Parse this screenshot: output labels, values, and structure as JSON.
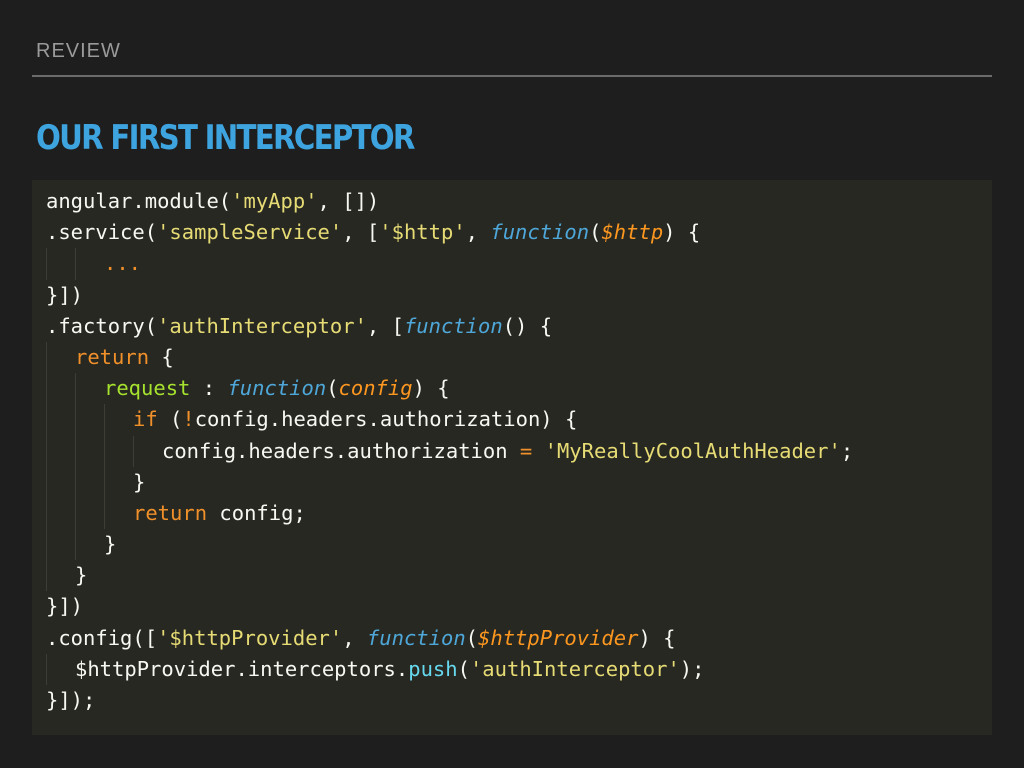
{
  "slide": {
    "section_label": "REVIEW",
    "title": "OUR FIRST INTERCEPTOR"
  },
  "code": {
    "language": "javascript",
    "lines": [
      {
        "indent": 0,
        "tokens": [
          {
            "t": "angular.module(",
            "k": "plain"
          },
          {
            "t": "'myApp'",
            "k": "string"
          },
          {
            "t": ", [])",
            "k": "plain"
          }
        ]
      },
      {
        "indent": 0,
        "tokens": [
          {
            "t": ".service(",
            "k": "plain"
          },
          {
            "t": "'sampleService'",
            "k": "string"
          },
          {
            "t": ", [",
            "k": "plain"
          },
          {
            "t": "'$http'",
            "k": "string"
          },
          {
            "t": ", ",
            "k": "plain"
          },
          {
            "t": "function",
            "k": "func"
          },
          {
            "t": "(",
            "k": "plain"
          },
          {
            "t": "$http",
            "k": "param"
          },
          {
            "t": ") {",
            "k": "plain"
          }
        ]
      },
      {
        "indent": 2,
        "tokens": [
          {
            "t": "...",
            "k": "kw"
          }
        ]
      },
      {
        "indent": 0,
        "tokens": [
          {
            "t": "}])",
            "k": "plain"
          }
        ]
      },
      {
        "indent": 0,
        "tokens": [
          {
            "t": ".factory(",
            "k": "plain"
          },
          {
            "t": "'authInterceptor'",
            "k": "string"
          },
          {
            "t": ", [",
            "k": "plain"
          },
          {
            "t": "function",
            "k": "func"
          },
          {
            "t": "() {",
            "k": "plain"
          }
        ]
      },
      {
        "indent": 1,
        "tokens": [
          {
            "t": "return",
            "k": "kw"
          },
          {
            "t": " {",
            "k": "plain"
          }
        ]
      },
      {
        "indent": 2,
        "tokens": [
          {
            "t": "request",
            "k": "prop"
          },
          {
            "t": " : ",
            "k": "plain"
          },
          {
            "t": "function",
            "k": "func"
          },
          {
            "t": "(",
            "k": "plain"
          },
          {
            "t": "config",
            "k": "param"
          },
          {
            "t": ") {",
            "k": "plain"
          }
        ]
      },
      {
        "indent": 3,
        "tokens": [
          {
            "t": "if",
            "k": "kw"
          },
          {
            "t": " (",
            "k": "plain"
          },
          {
            "t": "!",
            "k": "kw"
          },
          {
            "t": "config.headers.authorization) {",
            "k": "plain"
          }
        ]
      },
      {
        "indent": 4,
        "tokens": [
          {
            "t": "config.headers.authorization ",
            "k": "plain"
          },
          {
            "t": "=",
            "k": "kw"
          },
          {
            "t": " ",
            "k": "plain"
          },
          {
            "t": "'MyReallyCoolAuthHeader'",
            "k": "string"
          },
          {
            "t": ";",
            "k": "plain"
          }
        ]
      },
      {
        "indent": 3,
        "tokens": [
          {
            "t": "}",
            "k": "plain"
          }
        ]
      },
      {
        "indent": 3,
        "tokens": [
          {
            "t": "return",
            "k": "kw"
          },
          {
            "t": " config;",
            "k": "plain"
          }
        ]
      },
      {
        "indent": 2,
        "tokens": [
          {
            "t": "}",
            "k": "plain"
          }
        ]
      },
      {
        "indent": 1,
        "tokens": [
          {
            "t": "}",
            "k": "plain"
          }
        ]
      },
      {
        "indent": 0,
        "tokens": [
          {
            "t": "}])",
            "k": "plain"
          }
        ]
      },
      {
        "indent": 0,
        "tokens": [
          {
            "t": ".config([",
            "k": "plain"
          },
          {
            "t": "'$httpProvider'",
            "k": "string"
          },
          {
            "t": ", ",
            "k": "plain"
          },
          {
            "t": "function",
            "k": "func"
          },
          {
            "t": "(",
            "k": "plain"
          },
          {
            "t": "$httpProvider",
            "k": "param"
          },
          {
            "t": ") {",
            "k": "plain"
          }
        ]
      },
      {
        "indent": 1,
        "tokens": [
          {
            "t": "$httpProvider.interceptors.",
            "k": "plain"
          },
          {
            "t": "push",
            "k": "call"
          },
          {
            "t": "(",
            "k": "plain"
          },
          {
            "t": "'authInterceptor'",
            "k": "string"
          },
          {
            "t": ");",
            "k": "plain"
          }
        ]
      },
      {
        "indent": 0,
        "tokens": [
          {
            "t": "}]);",
            "k": "plain"
          }
        ]
      }
    ]
  },
  "colors": {
    "background": "#1e1e1e",
    "code_background": "#272822",
    "title": "#3ea4e0",
    "section_label": "#9a9a9a",
    "string": "#e6db74",
    "function_keyword": "#4ea7d8",
    "parameter": "#fd971f",
    "keyword": "#f0902a",
    "property": "#a6e22e",
    "method_call": "#66d9ef",
    "plain_text": "#f8f8f2"
  }
}
